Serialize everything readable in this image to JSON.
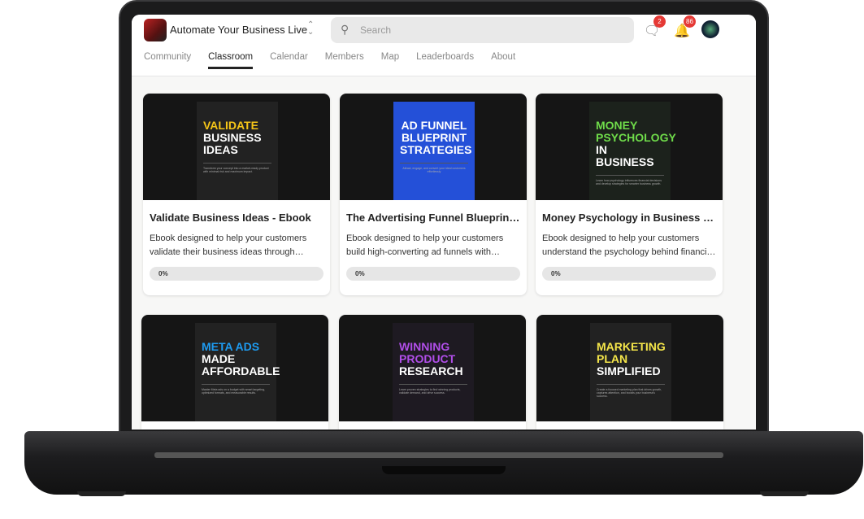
{
  "header": {
    "group_name": "Automate Your Business Live",
    "search_placeholder": "Search",
    "chat_badge": "2",
    "notification_badge": "86"
  },
  "tabs": [
    "Community",
    "Classroom",
    "Calendar",
    "Members",
    "Map",
    "Leaderboards",
    "About"
  ],
  "active_tab": "Classroom",
  "courses": [
    {
      "title": "Validate Business Ideas - Ebook",
      "description": "Ebook designed to help your customers validate their business ideas through market research",
      "progress_label": "0%",
      "progress": 0,
      "cover_line1": "VALIDATE",
      "cover_line2": "BUSINESS IDEAS",
      "cover_desc": "Transform your concept into a market-ready product with minimal risk and maximum impact.",
      "accent": "#f5c518",
      "bg": "#222"
    },
    {
      "title": "The Advertising Funnel Blueprint - Ebook",
      "description": "Ebook designed to help your customers build high-converting ad funnels with proven strategies",
      "progress_label": "0%",
      "progress": 0,
      "cover_line1": "AD FUNNEL",
      "cover_line2": "BLUEPRINT STRATEGIES",
      "cover_desc": "Attract, engage, and convert your ideal customers effortlessly",
      "accent": "#ffffff",
      "bg": "#2450d8"
    },
    {
      "title": "Money Psychology in Business - Ebook",
      "description": "Ebook designed to help your customers understand the psychology behind financial decisions",
      "progress_label": "0%",
      "progress": 0,
      "cover_line1": "MONEY PSYCHOLOGY",
      "cover_line2": "IN BUSINESS",
      "cover_desc": "Learn how psychology influences financial decisions and develop strategies for smarter business growth.",
      "accent": "#6fdc4a",
      "bg": "#1c221c"
    },
    {
      "title": "",
      "description": "",
      "cover_line1": "META ADS",
      "cover_line2": "MADE AFFORDABLE",
      "cover_desc": "Master Meta ads on a budget with smart targeting, optimized formats, and measurable results.",
      "accent": "#1e9bf0",
      "bg": "#222"
    },
    {
      "title": "",
      "description": "",
      "cover_line1": "WINNING PRODUCT",
      "cover_line2": "RESEARCH",
      "cover_desc": "Learn proven strategies to find winning products, validate demand, and drive success.",
      "accent": "#b04ee8",
      "bg": "#1e1a22"
    },
    {
      "title": "",
      "description": "",
      "cover_line1": "MARKETING PLAN",
      "cover_line2": "SIMPLIFIED",
      "cover_desc": "Create a focused marketing plan that drives growth, captures attention, and boosts your business's success.",
      "accent": "#f5e64a",
      "bg": "#222"
    }
  ]
}
